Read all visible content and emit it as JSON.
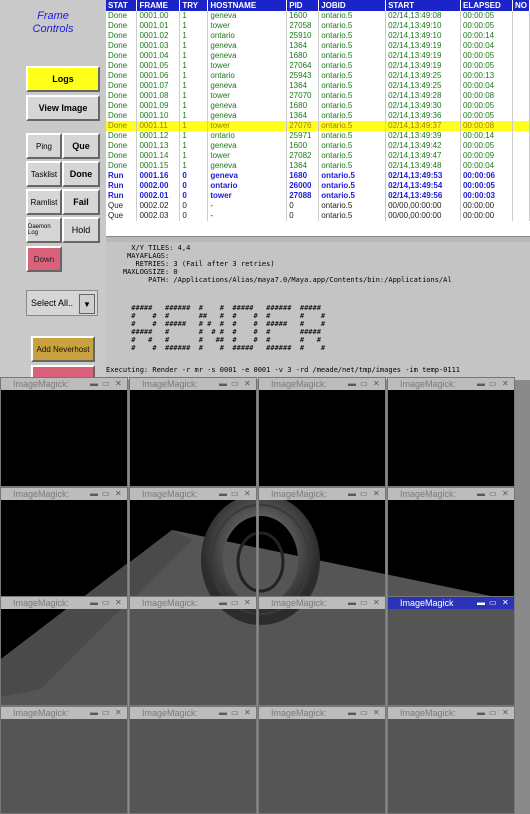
{
  "left_panel": {
    "title_line1": "Frame",
    "title_line2": "Controls",
    "logs": "Logs",
    "view_image": "View Image",
    "ping": "Ping",
    "que": "Que",
    "tasklist": "Tasklist",
    "done": "Done",
    "ramlist": "Ramlist",
    "fail": "Fail",
    "daemon_log": "Daemon Log",
    "hold": "Hold",
    "down": "Down",
    "select_all": "Select All..",
    "add_neverhost": "Add Neverhost"
  },
  "table": {
    "headers": [
      "STAT",
      "FRAME",
      "TRY",
      "HOSTNAME",
      "PID",
      "JOBID",
      "START",
      "ELAPSED",
      "NO"
    ],
    "rows": [
      {
        "stat": "Done",
        "frame": "0001.00",
        "try": "1",
        "host": "geneva",
        "pid": "1600",
        "jobid": "ontario.5",
        "start": "02/14,13:49:08",
        "elapsed": "00:00:05"
      },
      {
        "stat": "Done",
        "frame": "0001.01",
        "try": "1",
        "host": "tower",
        "pid": "27058",
        "jobid": "ontario.5",
        "start": "02/14,13:49:10",
        "elapsed": "00:00:05"
      },
      {
        "stat": "Done",
        "frame": "0001.02",
        "try": "1",
        "host": "ontario",
        "pid": "25910",
        "jobid": "ontario.5",
        "start": "02/14,13:49:10",
        "elapsed": "00:00:14"
      },
      {
        "stat": "Done",
        "frame": "0001.03",
        "try": "1",
        "host": "geneva",
        "pid": "1364",
        "jobid": "ontario.5",
        "start": "02/14,13:49:19",
        "elapsed": "00:00:04"
      },
      {
        "stat": "Done",
        "frame": "0001.04",
        "try": "1",
        "host": "geneva",
        "pid": "1680",
        "jobid": "ontario.5",
        "start": "02/14,13:49:19",
        "elapsed": "00:00:05"
      },
      {
        "stat": "Done",
        "frame": "0001.05",
        "try": "1",
        "host": "tower",
        "pid": "27064",
        "jobid": "ontario.5",
        "start": "02/14,13:49:19",
        "elapsed": "00:00:05"
      },
      {
        "stat": "Done",
        "frame": "0001.06",
        "try": "1",
        "host": "ontario",
        "pid": "25943",
        "jobid": "ontario.5",
        "start": "02/14,13:49:25",
        "elapsed": "00:00:13"
      },
      {
        "stat": "Done",
        "frame": "0001.07",
        "try": "1",
        "host": "geneva",
        "pid": "1364",
        "jobid": "ontario.5",
        "start": "02/14,13:49:25",
        "elapsed": "00:00:04"
      },
      {
        "stat": "Done",
        "frame": "0001.08",
        "try": "1",
        "host": "tower",
        "pid": "27070",
        "jobid": "ontario.5",
        "start": "02/14,13:49:28",
        "elapsed": "00:00:08"
      },
      {
        "stat": "Done",
        "frame": "0001.09",
        "try": "1",
        "host": "geneva",
        "pid": "1680",
        "jobid": "ontario.5",
        "start": "02/14,13:49:30",
        "elapsed": "00:00:05"
      },
      {
        "stat": "Done",
        "frame": "0001.10",
        "try": "1",
        "host": "geneva",
        "pid": "1364",
        "jobid": "ontario.5",
        "start": "02/14,13:49:36",
        "elapsed": "00:00:05"
      },
      {
        "stat": "Done",
        "frame": "0001.11",
        "try": "1",
        "host": "tower",
        "pid": "27076",
        "jobid": "ontario.5",
        "start": "02/14,13:49:37",
        "elapsed": "00:00:08",
        "selected": true
      },
      {
        "stat": "Done",
        "frame": "0001.12",
        "try": "1",
        "host": "ontario",
        "pid": "25971",
        "jobid": "ontario.5",
        "start": "02/14,13:49:39",
        "elapsed": "00:00:14"
      },
      {
        "stat": "Done",
        "frame": "0001.13",
        "try": "1",
        "host": "geneva",
        "pid": "1600",
        "jobid": "ontario.5",
        "start": "02/14,13:49:42",
        "elapsed": "00:00:05"
      },
      {
        "stat": "Done",
        "frame": "0001.14",
        "try": "1",
        "host": "tower",
        "pid": "27082",
        "jobid": "ontario.5",
        "start": "02/14,13:49:47",
        "elapsed": "00:00:09"
      },
      {
        "stat": "Done",
        "frame": "0001.15",
        "try": "1",
        "host": "geneva",
        "pid": "1364",
        "jobid": "ontario.5",
        "start": "02/14,13:49:48",
        "elapsed": "00:00:04"
      },
      {
        "stat": "Run",
        "frame": "0001.16",
        "try": "0",
        "host": "geneva",
        "pid": "1680",
        "jobid": "ontario.5",
        "start": "02/14,13:49:53",
        "elapsed": "00:00:06"
      },
      {
        "stat": "Run",
        "frame": "0002.00",
        "try": "0",
        "host": "ontario",
        "pid": "26000",
        "jobid": "ontario.5",
        "start": "02/14,13:49:54",
        "elapsed": "00:00:05"
      },
      {
        "stat": "Run",
        "frame": "0002.01",
        "try": "0",
        "host": "tower",
        "pid": "27088",
        "jobid": "ontario.5",
        "start": "02/14,13:49:56",
        "elapsed": "00:00:03"
      },
      {
        "stat": "Que",
        "frame": "0002.02",
        "try": "0",
        "host": "-",
        "pid": "0",
        "jobid": "ontario.5",
        "start": "00/00,00:00:00",
        "elapsed": "00:00:00"
      },
      {
        "stat": "Que",
        "frame": "0002.03",
        "try": "0",
        "host": "-",
        "pid": "0",
        "jobid": "ontario.5",
        "start": "00/00,00:00:00",
        "elapsed": "00:00:00"
      }
    ]
  },
  "log": {
    "lines": [
      "      X/Y TILES: 4,4",
      "     MAYAFLAGS:",
      "       RETRIES: 3 (Fail after 3 retries)",
      "    MAXLOGSIZE: 0",
      "          PATH: /Applications/Alias/maya7.0/Maya.app/Contents/bin:/Applications/Al",
      "",
      "      #####   ######  #    #  #####   ######  #####",
      "      #    #  #       ##   #  #    #  #       #    #",
      "      #    #  #####   # #  #  #    #  #####   #    #",
      "      #####   #       #  # #  #    #  #       #####",
      "      #   #   #       #   ##  #    #  #       #   #",
      "      #    #  ######  #    #  #####   ######  #    #",
      "",
      "Executing: Render -r mr -s 0001 -e 0001 -v 3 -rd /meade/net/tmp/images -im temp-0111"
    ]
  },
  "image_windows": {
    "title": "ImageMagick:",
    "active_title": "ImageMagick",
    "min_glyph": "▬",
    "max_glyph": "▭",
    "close_glyph": "✕"
  },
  "colors": {
    "header_blue": "#1a24c8",
    "done_green": "#1a7a1a",
    "run_blue": "#1c1cd4",
    "selection_yellow": "#ffff1a",
    "floor_gray": "#5a5a5a",
    "active_titlebar": "#2b34b8"
  }
}
